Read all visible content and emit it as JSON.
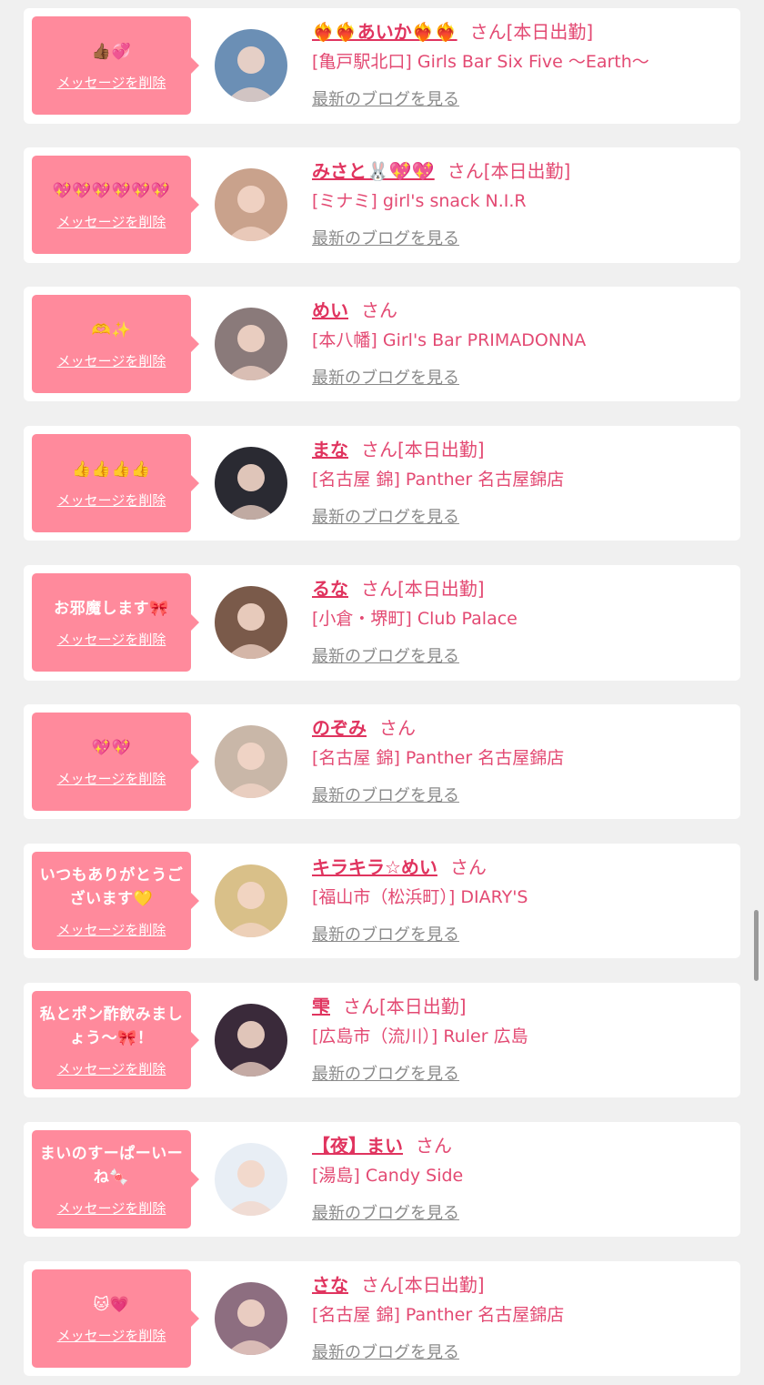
{
  "cards": [
    {
      "message": "👍🏾💞",
      "delete_label": "メッセージを削除",
      "name": "❤️‍🔥❤️‍🔥あいか❤️‍🔥❤️‍🔥",
      "honorific": "さん",
      "status": "[本日出勤]",
      "shop": "[亀戸駅北口] Girls Bar Six Five 〜Earth〜",
      "blog_label": "最新のブログを見る",
      "avatar_color": "#6b8fb5"
    },
    {
      "message": "💖💖💖💖💖💖",
      "delete_label": "メッセージを削除",
      "name": "みさと🐰💖💖",
      "honorific": "さん",
      "status": "[本日出勤]",
      "shop": "[ミナミ] girl's snack N.I.R",
      "blog_label": "最新のブログを見る",
      "avatar_color": "#c9a28c"
    },
    {
      "message": "🫶✨",
      "delete_label": "メッセージを削除",
      "name": "めい",
      "honorific": "さん",
      "status": "",
      "shop": "[本八幡] Girl's Bar PRIMADONNA",
      "blog_label": "最新のブログを見る",
      "avatar_color": "#8a7a7a"
    },
    {
      "message": "👍👍👍👍",
      "delete_label": "メッセージを削除",
      "name": "まな",
      "honorific": "さん",
      "status": "[本日出勤]",
      "shop": "[名古屋 錦] Panther 名古屋錦店",
      "blog_label": "最新のブログを見る",
      "avatar_color": "#2a2a32"
    },
    {
      "message": "お邪魔します🎀",
      "delete_label": "メッセージを削除",
      "name": "るな",
      "honorific": "さん",
      "status": "[本日出勤]",
      "shop": "[小倉・堺町] Club Palace",
      "blog_label": "最新のブログを見る",
      "avatar_color": "#7a5a4a"
    },
    {
      "message": "💖💖",
      "delete_label": "メッセージを削除",
      "name": "のぞみ",
      "honorific": "さん",
      "status": "",
      "shop": "[名古屋 錦] Panther 名古屋錦店",
      "blog_label": "最新のブログを見る",
      "avatar_color": "#c9b7a8"
    },
    {
      "message": "いつもありがとうございます💛",
      "delete_label": "メッセージを削除",
      "name": "キラキラ☆めい",
      "honorific": "さん",
      "status": "",
      "shop": "[福山市（松浜町）] DIARY'S",
      "blog_label": "最新のブログを見る",
      "avatar_color": "#d9c089"
    },
    {
      "message": "私とポン酢飲みましょう〜🎀！",
      "delete_label": "メッセージを削除",
      "name": "雫",
      "honorific": "さん",
      "status": "[本日出勤]",
      "shop": "[広島市（流川）] Ruler 広島",
      "blog_label": "最新のブログを見る",
      "avatar_color": "#3a2a3a"
    },
    {
      "message": "まいのすーぱーいーね🍬",
      "delete_label": "メッセージを削除",
      "name": "【夜】まい",
      "honorific": "さん",
      "status": "",
      "shop": "[湯島] Candy Side",
      "blog_label": "最新のブログを見る",
      "avatar_color": "#e8eef5"
    },
    {
      "message": "🐱💗",
      "delete_label": "メッセージを削除",
      "name": "さな",
      "honorific": "さん",
      "status": "[本日出勤]",
      "shop": "[名古屋 錦] Panther 名古屋錦店",
      "blog_label": "最新のブログを見る",
      "avatar_color": "#8d6e80"
    }
  ]
}
